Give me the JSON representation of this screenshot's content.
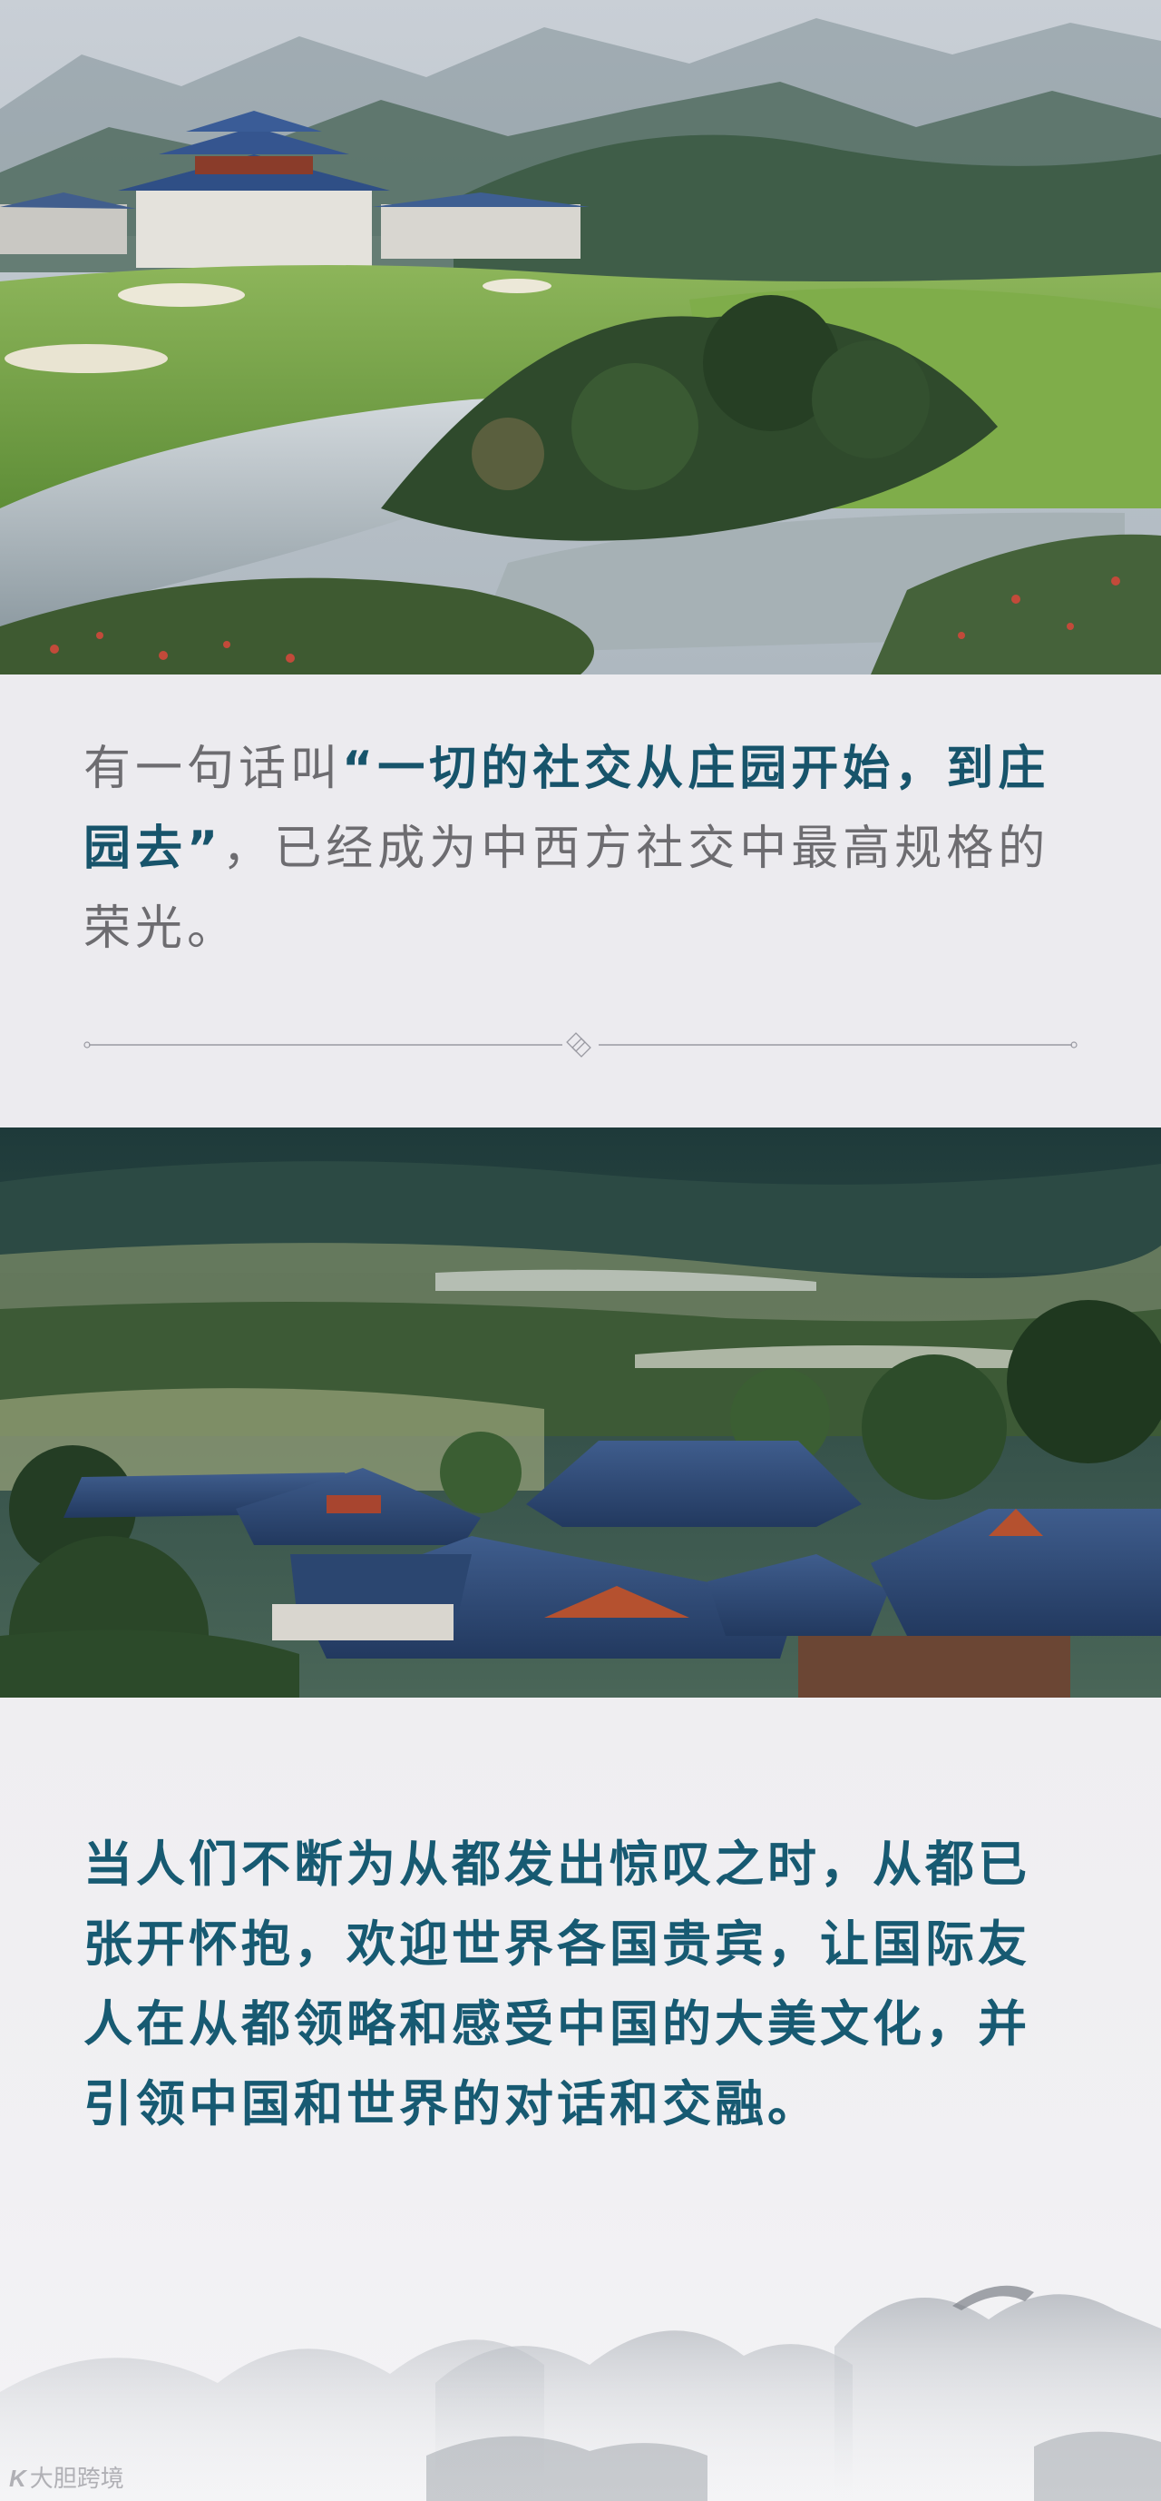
{
  "paragraph_1": {
    "intro": "有一句话叫",
    "quote": "“一切的社交从庄园开始，到庄园去”",
    "outro": "，已经成为中西方社交中最高规格的荣光。"
  },
  "paragraph_2": {
    "text": "当人们不断为从都发出惊叹之时，从都已张开怀抱，欢迎世界各国贵宾，让国际友人在从都领略和感受中国的大美文化，并引领中国和世界的对话和交融。"
  },
  "watermark": {
    "logo": "K",
    "text": "大胆跨境"
  },
  "colors": {
    "highlight": "#17546b",
    "body_text": "#6d6c70",
    "panel_bg": "#ecebef"
  }
}
